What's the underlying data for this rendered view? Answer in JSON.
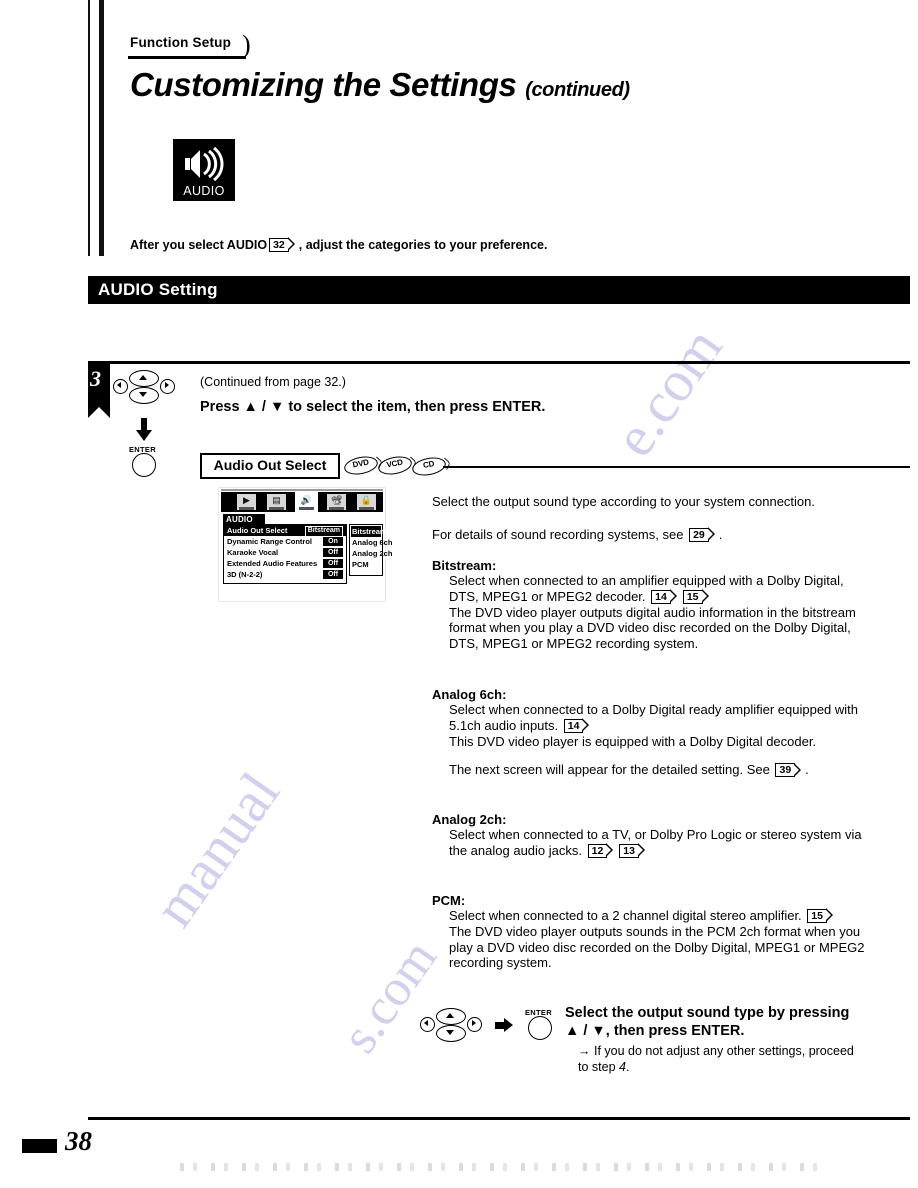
{
  "header": {
    "kicker": "Function Setup",
    "title": "Customizing the Settings",
    "title_suffix": "(continued)"
  },
  "audio_badge": {
    "label": "AUDIO",
    "icon": "speaker-waves-icon"
  },
  "intro": {
    "text_before": "After you select AUDIO",
    "page_ref": "32",
    "text_after": ", adjust the categories to your preference."
  },
  "section_bar": {
    "title": "AUDIO Setting"
  },
  "step": {
    "number": "3",
    "continued_from": "(Continued from page 32.)",
    "instruction": "Press ▲ / ▼ to select the item, then press ENTER.",
    "enter_label": "ENTER"
  },
  "setting": {
    "name": "Audio Out Select",
    "discs": [
      "DVD",
      "VCD",
      "CD"
    ]
  },
  "osd": {
    "menu_tab": "AUDIO",
    "icons": [
      "play-icon",
      "display-icon",
      "audio-speaker-icon",
      "screen-icon",
      "lock-icon"
    ],
    "selected_icon_index": 2,
    "rows": [
      {
        "name": "Audio Out Select",
        "value": "Bitstream",
        "highlighted": true
      },
      {
        "name": "Dynamic Range Control",
        "value": "On",
        "highlighted": false
      },
      {
        "name": "Karaoke Vocal",
        "value": "Off",
        "highlighted": false
      },
      {
        "name": "Extended Audio Features",
        "value": "Off",
        "highlighted": false
      },
      {
        "name": "3D (N-2-2)",
        "value": "Off",
        "highlighted": false
      }
    ],
    "submenu": {
      "options": [
        "Bitstream",
        "Analog 6ch",
        "Analog 2ch",
        "PCM"
      ],
      "selected": "Bitstream"
    }
  },
  "body": {
    "lead": "Select the output sound type according to your system connection.",
    "details_before": "For details of sound recording systems, see",
    "details_ref": "29",
    "details_after": ".",
    "blocks": [
      {
        "term": "Bitstream:",
        "line1": "Select when connected to an amplifier equipped with a Dolby Digital,",
        "line2_before": "DTS, MPEG1 or MPEG2 decoder.",
        "refs": [
          "14",
          "15"
        ],
        "line3": "The DVD video player outputs digital audio information in the bitstream",
        "line4": "format when you play a DVD video disc recorded on the Dolby Digital,",
        "line5": "DTS, MPEG1 or MPEG2 recording system."
      },
      {
        "term": "Analog 6ch:",
        "line1": "Select when connected to a Dolby Digital ready amplifier equipped with",
        "line2_before": "5.1ch audio inputs.",
        "refs": [
          "14"
        ],
        "line3": "This DVD video player is equipped with a Dolby Digital decoder.",
        "note_before": "The next screen will appear for the detailed setting. See",
        "note_ref": "39",
        "note_after": "."
      },
      {
        "term": "Analog 2ch:",
        "line1": "Select when connected to a TV, or Dolby Pro Logic or stereo system via",
        "line2_before": "the analog audio jacks.",
        "refs": [
          "12",
          "13"
        ]
      },
      {
        "term": "PCM:",
        "line1_before": "Select when connected to a 2 channel digital stereo amplifier.",
        "refs": [
          "15"
        ],
        "line3": "The DVD video player outputs sounds in the PCM 2ch format when you",
        "line4": "play a DVD video disc recorded on the Dolby Digital, MPEG1 or MPEG2",
        "line5": "recording system."
      }
    ]
  },
  "final": {
    "enter_label": "ENTER",
    "instruction_line1": "Select the output sound type by pressing",
    "instruction_line2": "▲ / ▼,  then press ENTER.",
    "note_line1": "→ If you do not adjust any other settings, proceed",
    "note_line2_before": "to step ",
    "note_line2_italic": "4",
    "note_line2_after": "."
  },
  "footer": {
    "page_number": "38"
  },
  "watermark": {
    "line1": "e.com",
    "line2": "manual",
    "line3": "s.com"
  }
}
